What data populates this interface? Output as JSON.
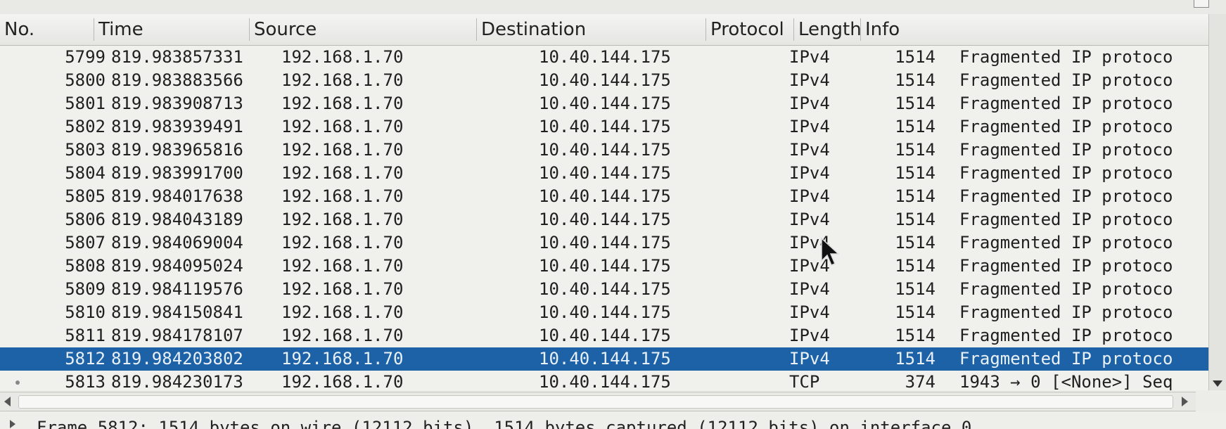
{
  "header": {
    "no": "No.",
    "time": "Time",
    "source": "Source",
    "destination": "Destination",
    "protocol": "Protocol",
    "length": "Length",
    "info": "Info"
  },
  "packets": [
    {
      "no": "5799",
      "time": "819.983857331",
      "source": "192.168.1.70",
      "destination": "10.40.144.175",
      "protocol": "IPv4",
      "length": "1514",
      "info": "Fragmented IP protoco"
    },
    {
      "no": "5800",
      "time": "819.983883566",
      "source": "192.168.1.70",
      "destination": "10.40.144.175",
      "protocol": "IPv4",
      "length": "1514",
      "info": "Fragmented IP protoco"
    },
    {
      "no": "5801",
      "time": "819.983908713",
      "source": "192.168.1.70",
      "destination": "10.40.144.175",
      "protocol": "IPv4",
      "length": "1514",
      "info": "Fragmented IP protoco"
    },
    {
      "no": "5802",
      "time": "819.983939491",
      "source": "192.168.1.70",
      "destination": "10.40.144.175",
      "protocol": "IPv4",
      "length": "1514",
      "info": "Fragmented IP protoco"
    },
    {
      "no": "5803",
      "time": "819.983965816",
      "source": "192.168.1.70",
      "destination": "10.40.144.175",
      "protocol": "IPv4",
      "length": "1514",
      "info": "Fragmented IP protoco"
    },
    {
      "no": "5804",
      "time": "819.983991700",
      "source": "192.168.1.70",
      "destination": "10.40.144.175",
      "protocol": "IPv4",
      "length": "1514",
      "info": "Fragmented IP protoco"
    },
    {
      "no": "5805",
      "time": "819.984017638",
      "source": "192.168.1.70",
      "destination": "10.40.144.175",
      "protocol": "IPv4",
      "length": "1514",
      "info": "Fragmented IP protoco"
    },
    {
      "no": "5806",
      "time": "819.984043189",
      "source": "192.168.1.70",
      "destination": "10.40.144.175",
      "protocol": "IPv4",
      "length": "1514",
      "info": "Fragmented IP protoco"
    },
    {
      "no": "5807",
      "time": "819.984069004",
      "source": "192.168.1.70",
      "destination": "10.40.144.175",
      "protocol": "IPv4",
      "length": "1514",
      "info": "Fragmented IP protoco"
    },
    {
      "no": "5808",
      "time": "819.984095024",
      "source": "192.168.1.70",
      "destination": "10.40.144.175",
      "protocol": "IPv4",
      "length": "1514",
      "info": "Fragmented IP protoco"
    },
    {
      "no": "5809",
      "time": "819.984119576",
      "source": "192.168.1.70",
      "destination": "10.40.144.175",
      "protocol": "IPv4",
      "length": "1514",
      "info": "Fragmented IP protoco"
    },
    {
      "no": "5810",
      "time": "819.984150841",
      "source": "192.168.1.70",
      "destination": "10.40.144.175",
      "protocol": "IPv4",
      "length": "1514",
      "info": "Fragmented IP protoco"
    },
    {
      "no": "5811",
      "time": "819.984178107",
      "source": "192.168.1.70",
      "destination": "10.40.144.175",
      "protocol": "IPv4",
      "length": "1514",
      "info": "Fragmented IP protoco"
    },
    {
      "no": "5812",
      "time": "819.984203802",
      "source": "192.168.1.70",
      "destination": "10.40.144.175",
      "protocol": "IPv4",
      "length": "1514",
      "info": "Fragmented IP protoco",
      "selected": true
    },
    {
      "no": "5813",
      "time": "819.984230173",
      "source": "192.168.1.70",
      "destination": "10.40.144.175",
      "protocol": "TCP",
      "length": "374",
      "info": "1943 → 0 [<None>] Seq"
    }
  ],
  "details": {
    "frame_summary": "Frame 5812: 1514 bytes on wire (12112 bits), 1514 bytes captured (12112 bits) on interface 0"
  },
  "colors": {
    "selected_row": "#1d62a6",
    "selected_text": "#e9f0f8"
  }
}
